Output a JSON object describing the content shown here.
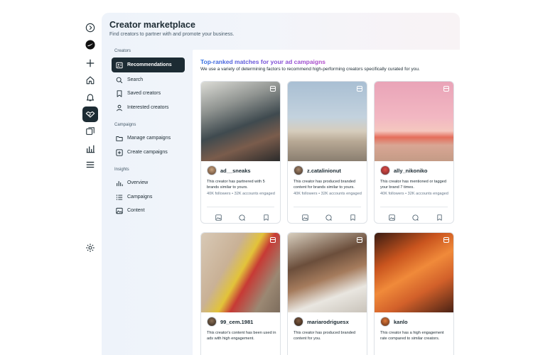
{
  "header": {
    "title": "Creator marketplace",
    "subtitle": "Find creators to partner with and promote your business."
  },
  "rail": {
    "icons": [
      "collapse-icon",
      "brand-avatar-icon",
      "plus-icon",
      "home-icon",
      "bell-icon",
      "handshake-icon",
      "gallery-icon",
      "bar-chart-icon",
      "menu-icon",
      "settings-icon"
    ]
  },
  "sidebar": {
    "sections": [
      {
        "title": "Creators",
        "items": [
          {
            "label": "Recommendations",
            "icon": "contact-card-icon",
            "active": true
          },
          {
            "label": "Search",
            "icon": "search-icon"
          },
          {
            "label": "Saved creators",
            "icon": "bookmark-icon"
          },
          {
            "label": "Interested creators",
            "icon": "person-icon"
          }
        ]
      },
      {
        "title": "Campaigns",
        "items": [
          {
            "label": "Manage campaigns",
            "icon": "folder-icon"
          },
          {
            "label": "Create campaigns",
            "icon": "plus-square-icon"
          }
        ]
      },
      {
        "title": "Insights",
        "items": [
          {
            "label": "Overview",
            "icon": "overview-chart-icon"
          },
          {
            "label": "Campaigns",
            "icon": "list-icon"
          },
          {
            "label": "Content",
            "icon": "image-icon"
          }
        ]
      }
    ]
  },
  "main": {
    "heading": "Top-ranked matches for your ad campaigns",
    "description": "We use a variety of determining factors to recommend high-performing creators specifically curated for you.",
    "cards": [
      {
        "handle": "ad__sneaks",
        "description": "This creator has partnered with 5 brands similar to yours.",
        "stats": "40K followers • 32K accounts engaged"
      },
      {
        "handle": "z.catalinionut",
        "description": "This creator has produced branded content for brands similar to yours.",
        "stats": "40K followers • 32K accounts engaged"
      },
      {
        "handle": "ally_nikoniko",
        "description": "This creator has mentioned or tagged your brand 7 times.",
        "stats": "40K followers • 32K accounts engaged"
      },
      {
        "handle": "99_cem.1981",
        "description": "This creator's content has been used in ads with high engagement.",
        "stats": ""
      },
      {
        "handle": "mariarodriguesx",
        "description": "This creator has produced branded content for you.",
        "stats": ""
      },
      {
        "handle": "kanlo",
        "description": "This creator has a high engagement rate compared to similar creators.",
        "stats": ""
      }
    ]
  },
  "colors": {
    "accent_dark": "#1c2b33",
    "heading_gradient": [
      "#2d6fe0",
      "#7a4fd8",
      "#b24ac9"
    ]
  }
}
